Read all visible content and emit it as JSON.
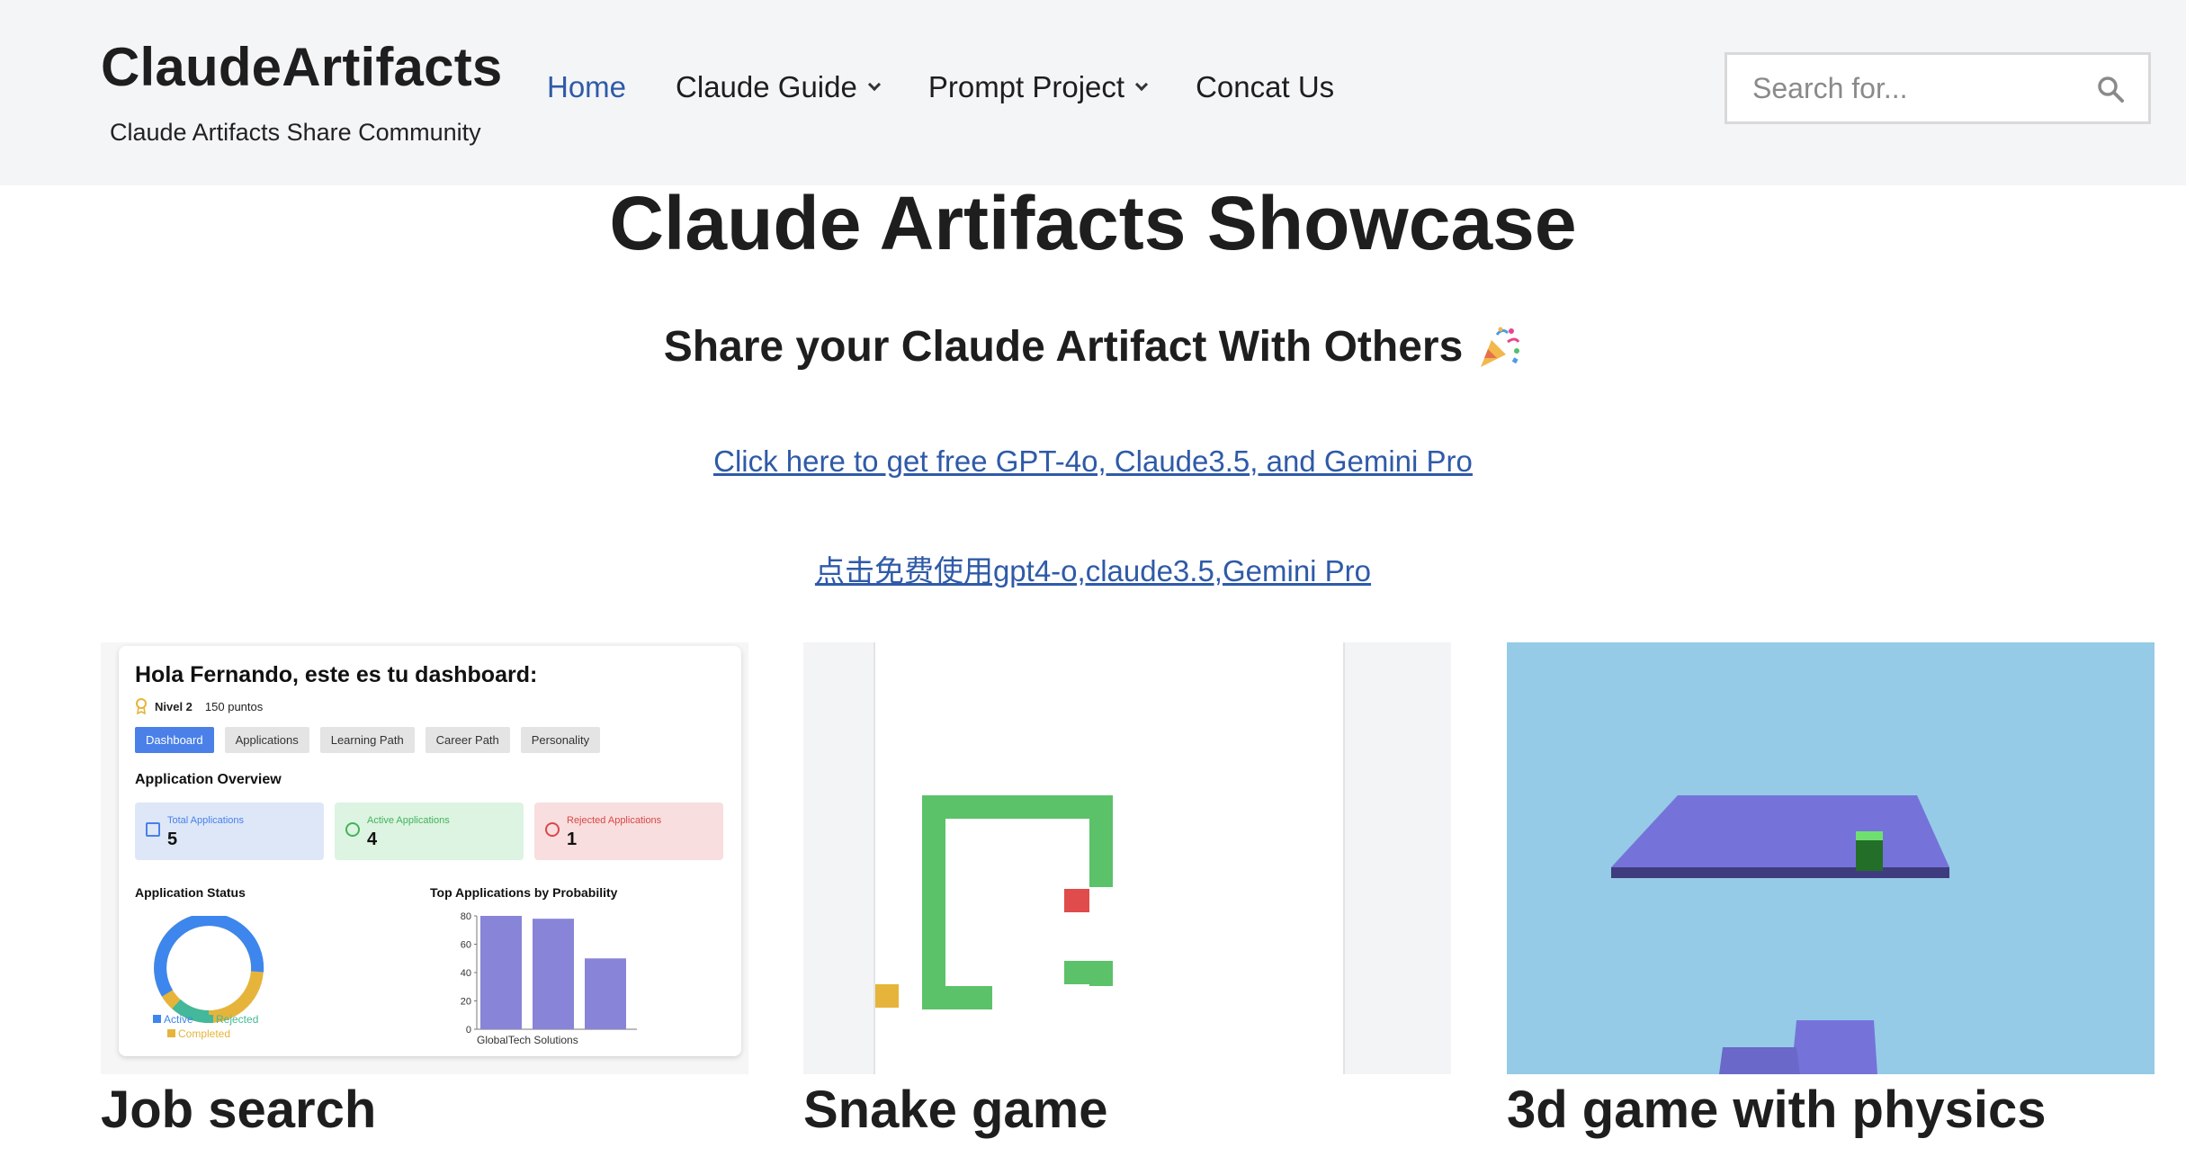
{
  "header": {
    "site_title": "ClaudeArtifacts",
    "tagline": "Claude Artifacts Share Community",
    "nav": [
      {
        "label": "Home",
        "active": true,
        "dropdown": false
      },
      {
        "label": "Claude Guide",
        "active": false,
        "dropdown": true
      },
      {
        "label": "Prompt Project",
        "active": false,
        "dropdown": true
      },
      {
        "label": "Concat Us",
        "active": false,
        "dropdown": false
      }
    ],
    "search": {
      "placeholder": "Search for...",
      "value": "",
      "icon": "search-icon"
    }
  },
  "main": {
    "title": "Claude Artifacts Showcase",
    "subtitle": "Share your Claude Artifact With Others",
    "subtitle_icon": "party-popper-icon",
    "links": [
      "Click here to get free GPT-4o, Claude3.5, and Gemini Pro",
      "点击免费使用gpt4-o,claude3.5,Gemini Pro"
    ]
  },
  "cards": [
    {
      "title": "Job search",
      "thumbnail": {
        "heading": "Hola Fernando, este es tu dashboard:",
        "level": "Nivel 2",
        "points": "150 puntos",
        "tabs": [
          "Dashboard",
          "Applications",
          "Learning Path",
          "Career Path",
          "Personality"
        ],
        "section": "Application Overview",
        "stats": [
          {
            "label": "Total Applications",
            "value": "5"
          },
          {
            "label": "Active Applications",
            "value": "4"
          },
          {
            "label": "Rejected Applications",
            "value": "1"
          }
        ],
        "status_heading": "Application Status",
        "status_legend": [
          "Active",
          "Rejected",
          "Completed"
        ],
        "prob_heading": "Top Applications by Probability",
        "prob_chart": {
          "type": "bar",
          "y_ticks": [
            "80",
            "60",
            "40",
            "20",
            "0"
          ],
          "values": [
            82,
            78,
            50
          ],
          "ylim": [
            0,
            80
          ],
          "x_label": "GlobalTech Solutions"
        }
      }
    },
    {
      "title": "Snake game"
    },
    {
      "title": "3d game with physics"
    }
  ],
  "colors": {
    "header_bg": "#f4f5f7",
    "link": "#2f5aa8",
    "snake_green": "#5bc26a",
    "food_red": "#e04b4b",
    "food_yellow": "#e6b43a",
    "sky": "#95cbe6",
    "platform": "#7573d9"
  }
}
